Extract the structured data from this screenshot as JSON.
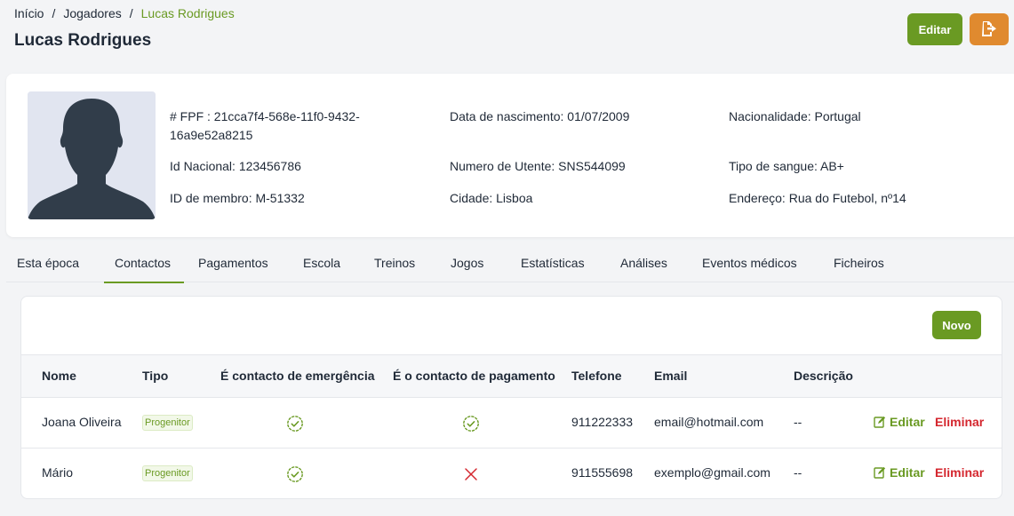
{
  "breadcrumb": {
    "home": "Início",
    "players": "Jogadores",
    "current": "Lucas Rodrigues"
  },
  "page_title": "Lucas Rodrigues",
  "header_actions": {
    "edit_label": "Editar",
    "export_icon": "sign-out-icon"
  },
  "profile": {
    "fpf": "# FPF : 21cca7f4-568e-11f0-9432-\n16a9e52a8215",
    "national_id": "Id Nacional: 123456786",
    "member_id": "ID de membro: M-51332",
    "birth_date": "Data de nascimento: 01/07/2009",
    "utente": "Numero de Utente: SNS544099",
    "city": "Cidade: Lisboa",
    "nationality": "Nacionalidade: Portugal",
    "blood_type": "Tipo de sangue: AB+",
    "address": "Endereço: Rua do Futebol, nº14"
  },
  "tabs": [
    {
      "label": "Esta época"
    },
    {
      "label": "Contactos",
      "active": true
    },
    {
      "label": "Pagamentos"
    },
    {
      "label": "Escola"
    },
    {
      "label": "Treinos"
    },
    {
      "label": "Jogos"
    },
    {
      "label": "Estatísticas"
    },
    {
      "label": "Análises"
    },
    {
      "label": "Eventos médicos"
    },
    {
      "label": "Ficheiros"
    }
  ],
  "contacts": {
    "new_label": "Novo",
    "columns": [
      "Nome",
      "Tipo",
      "É contacto de emergência",
      "É o contacto de pagamento",
      "Telefone",
      "Email",
      "Descrição"
    ],
    "rows": [
      {
        "name": "Joana Oliveira",
        "type": "Progenitor",
        "emergency": true,
        "payment": true,
        "phone": "911222333",
        "email": "email@hotmail.com",
        "description": "--",
        "edit_label": "Editar",
        "delete_label": "Eliminar"
      },
      {
        "name": "Mário",
        "type": "Progenitor",
        "emergency": true,
        "payment": false,
        "phone": "911555698",
        "email": "exemplo@gmail.com",
        "description": "--",
        "edit_label": "Editar",
        "delete_label": "Eliminar"
      }
    ]
  },
  "colors": {
    "accent": "#6a9a23",
    "export": "#e08a2f",
    "danger": "#d4262e"
  }
}
